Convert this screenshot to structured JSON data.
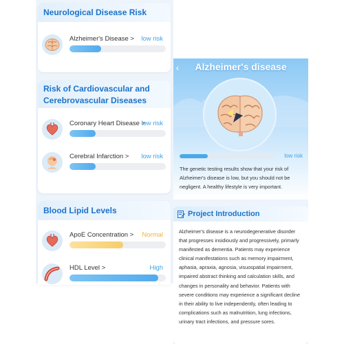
{
  "neuro": {
    "title": "Neurological Disease Risk",
    "items": [
      {
        "name": "Alzheimer's Disease >",
        "level": "low risk",
        "level_status": "low",
        "progress": 0.33,
        "icon": "brain-icon"
      }
    ]
  },
  "cardio": {
    "title_line1": "Risk of Cardiovascular and",
    "title_line2": "Cerebrovascular Diseases",
    "items": [
      {
        "name": "Coronary Heart Disease >",
        "level": "low risk",
        "level_status": "low",
        "progress": 0.27,
        "icon": "heart-icon"
      },
      {
        "name": "Cerebral Infarction >",
        "level": "low risk",
        "level_status": "low",
        "progress": 0.27,
        "icon": "head-icon"
      }
    ]
  },
  "lipid": {
    "title": "Blood Lipid Levels",
    "items": [
      {
        "name": "ApoE Concentration >",
        "level": "Normal",
        "level_status": "normal",
        "progress": 0.56,
        "icon": "heart-icon"
      },
      {
        "name": "HDL Level >",
        "level": "High",
        "level_status": "high",
        "progress": 0.92,
        "icon": "artery-icon"
      }
    ]
  },
  "detail": {
    "title": "Alzheimer's disease",
    "back_icon": "chevron-left-icon",
    "level": "low risk",
    "progress": 0.3,
    "description": "The genetic testing results show that your risk of Alzheimer's disease is low, but you should not be negligent. A healthy lifestyle is very important."
  },
  "intro": {
    "title": "Project Introduction",
    "icon": "document-edit-icon",
    "body": "Alzheimer's disease is a neurodegenerative disorder that progresses insidiously and progressively, primarly manifested as dementia. Patients may experience clinical manifestations such as memory impairment, aphasia, apraxia, agnosia, visuospatial impairment, impaired abstract thinking and calculation skills, and changes in personality and behavior. Patients with severe conditions may experience a significant decline in their ability to live independently, often leading to complications such as malnutrition, lung infections, urinary tract infections, and pressure sores."
  },
  "colors": {
    "title_blue": "#1c73c9",
    "low_risk": "#3ea2e6",
    "normal": "#f0b530"
  }
}
